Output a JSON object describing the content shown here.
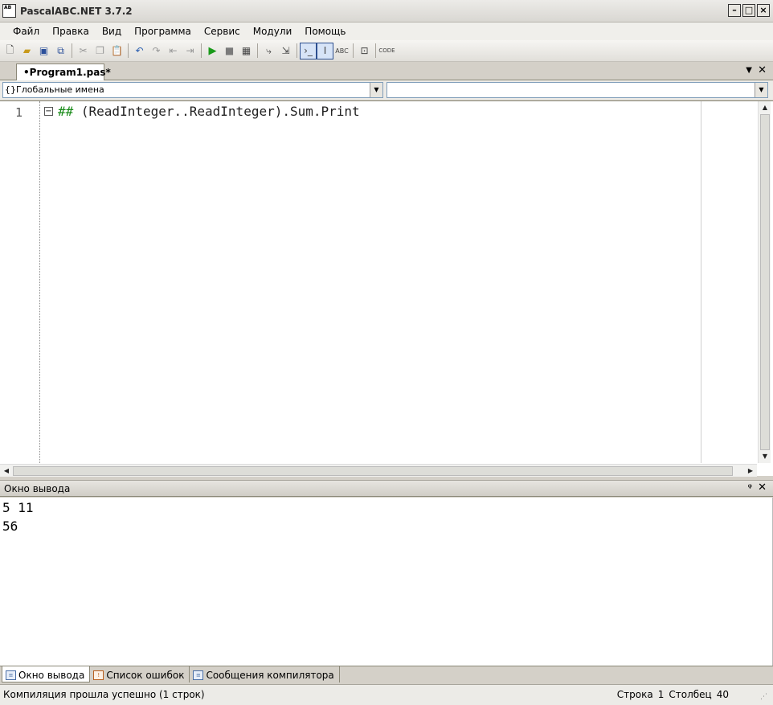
{
  "window": {
    "title": "PascalABC.NET 3.7.2",
    "app_icon_text": "AB",
    "minimize": "–",
    "maximize": "□",
    "close": "×"
  },
  "menu": [
    "Файл",
    "Правка",
    "Вид",
    "Программа",
    "Сервис",
    "Модули",
    "Помощь"
  ],
  "toolbar": {
    "icons": [
      "new-file-icon",
      "open-icon",
      "save-icon",
      "save-all-icon",
      "cut-icon",
      "copy-icon",
      "paste-icon",
      "undo-icon",
      "redo-icon",
      "nav-back-icon",
      "nav-forward-icon",
      "run-icon",
      "stop-icon",
      "compile-icon",
      "step-into-icon",
      "step-over-icon",
      "console-icon",
      "output-icon",
      "format-icon",
      "code-template-icon",
      "code-icon"
    ]
  },
  "doc_tab": {
    "label": "•Program1.pas*",
    "dropdown": "▼",
    "close": "✕"
  },
  "selectors": {
    "left_value": "{}Глобальные имена",
    "right_value": ""
  },
  "editor": {
    "line_number": "1",
    "fold_marker": "−",
    "code_hash": "##",
    "code_rest": " (ReadInteger..ReadInteger).Sum.Print"
  },
  "output_panel": {
    "title": "Окно вывода",
    "pin": "ᵠ",
    "close": "✕",
    "lines": [
      "5 11",
      "56"
    ]
  },
  "bottom_tabs": [
    "Окно вывода",
    "Список ошибок",
    "Сообщения компилятора"
  ],
  "status": {
    "message": "Компиляция прошла успешно (1 строк)",
    "row_label": "Строка",
    "row_value": "1",
    "col_label": "Столбец",
    "col_value": "40"
  }
}
